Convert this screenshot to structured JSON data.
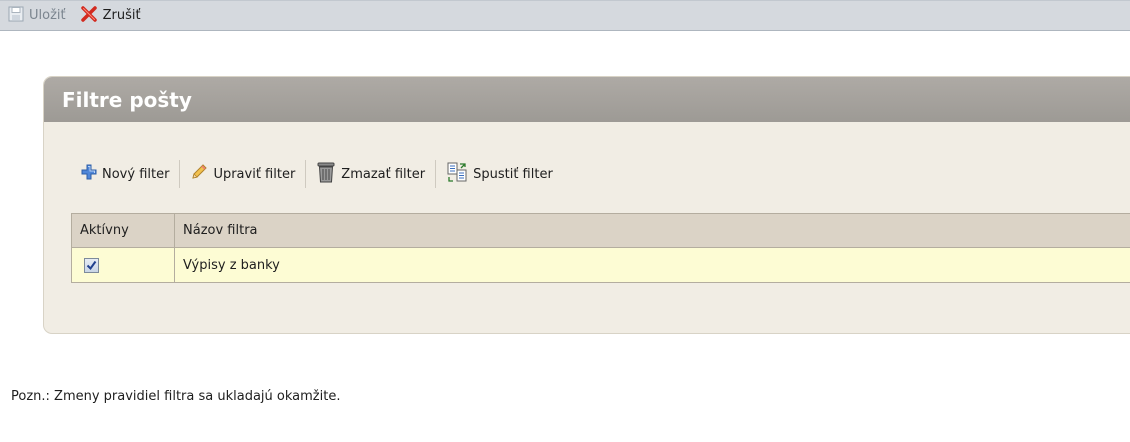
{
  "toolbar": {
    "save_label": "Uložiť",
    "cancel_label": "Zrušiť"
  },
  "panel": {
    "title": "Filtre pošty",
    "actions": {
      "new_label": "Nový filter",
      "edit_label": "Upraviť filter",
      "delete_label": "Zmazať filter",
      "run_label": "Spustiť filter"
    },
    "table": {
      "headers": [
        "Aktívny",
        "Názov filtra"
      ],
      "rows": [
        {
          "active": true,
          "name": "Výpisy z banky"
        }
      ]
    }
  },
  "note": "Pozn.: Zmeny pravidiel filtra sa ukladajú okamžite.",
  "icons": {
    "save": "disk-icon",
    "cancel": "red-x-icon",
    "new": "plus-icon",
    "edit": "pencil-icon",
    "delete": "trash-icon",
    "run": "run-filter-icon"
  },
  "colors": {
    "topbar": "#d5d9de",
    "panel_header": "#a5a29d",
    "panel_bg": "#f1ede4",
    "row_bg": "#fdfcd4",
    "header_bg": "#dbd3c6"
  }
}
